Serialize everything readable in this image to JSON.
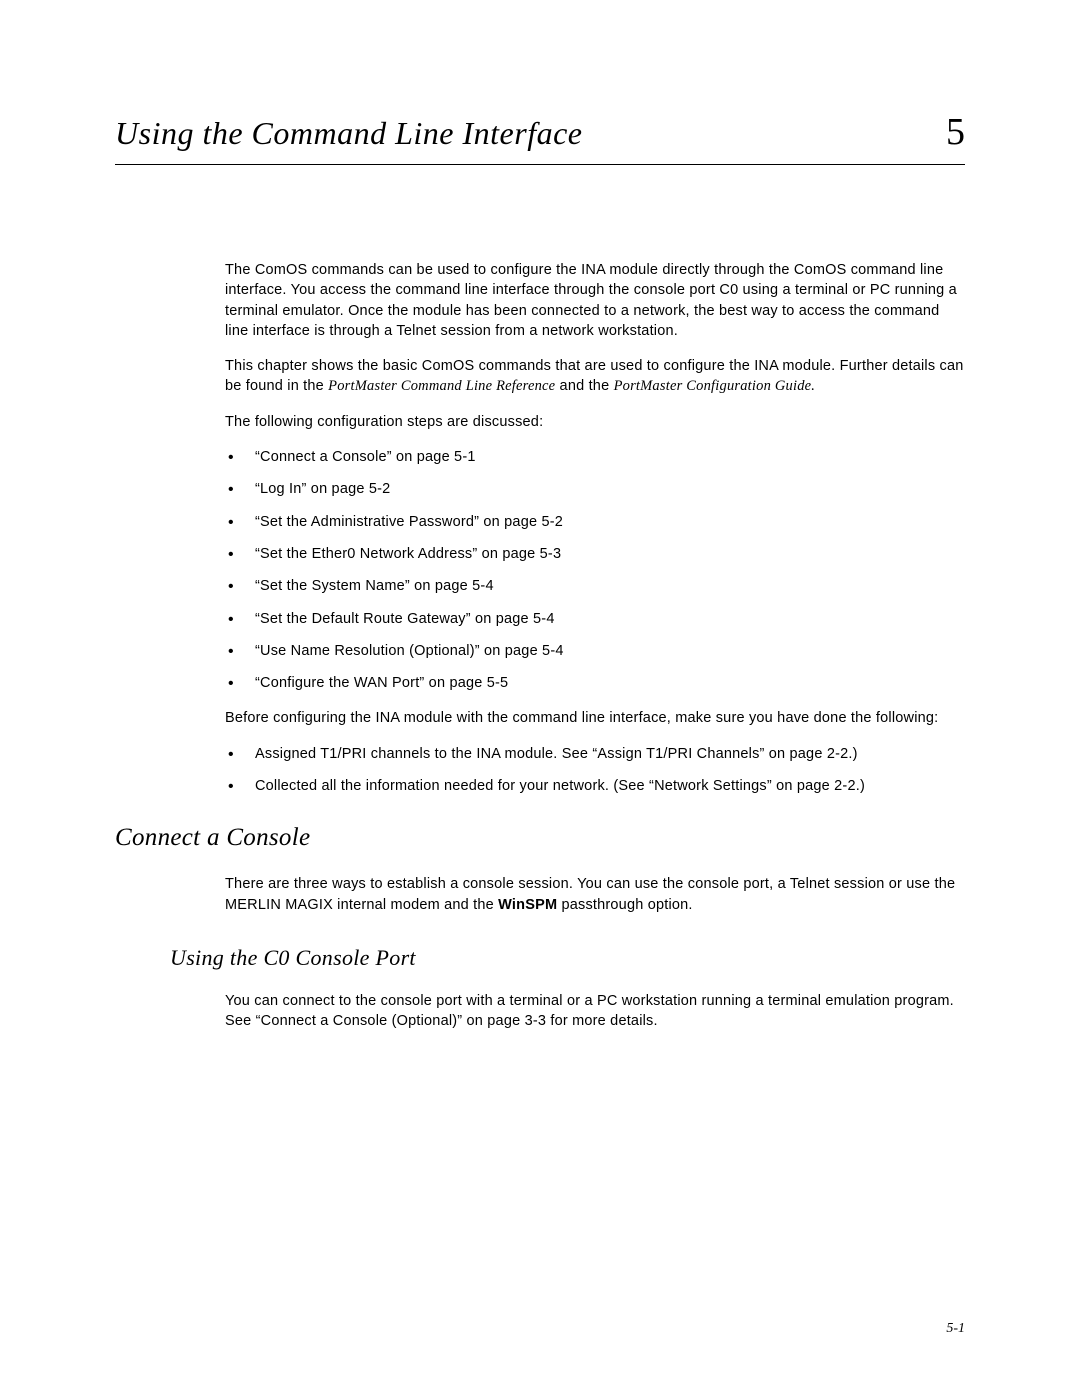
{
  "chapter": {
    "title": "Using the Command Line Interface",
    "number": "5"
  },
  "intro": {
    "p1": "The ComOS commands can be used to configure the INA module directly through the ComOS command line interface. You access the command line interface through the console port C0 using a terminal or PC running a terminal emulator. Once the module has been connected to a network, the best way to access the command line interface is through a Telnet session from a network workstation.",
    "p2a": "This chapter shows the basic ComOS commands that are used to configure the INA module. Further details can be found in the ",
    "p2_ital1": "PortMaster Command Line Reference",
    "p2b": " and the ",
    "p2_ital2": "PortMaster Configuration Guide.",
    "p3": "The following configuration steps are discussed:"
  },
  "steps": [
    "“Connect a Console” on page 5-1",
    "“Log In” on page 5-2",
    "“Set the Administrative Password” on page 5-2",
    "“Set the Ether0 Network Address” on page 5-3",
    "“Set the System Name” on page 5-4",
    "“Set the Default Route Gateway” on page 5-4",
    "“Use Name Resolution (Optional)” on page 5-4",
    "“Configure the WAN Port” on page 5-5"
  ],
  "prereq": {
    "intro": "Before configuring the INA module with the command line interface, make sure you have done the following:",
    "items": [
      "Assigned T1/PRI channels to the INA module. See “Assign T1/PRI Channels” on page 2-2.)",
      "Collected all the information needed for your network. (See “Network Settings” on page 2-2.)"
    ]
  },
  "section1": {
    "heading": "Connect a Console",
    "p1a": "There are three ways to establish a console session. You can use the console port, a Telnet session or use the MERLIN MAGIX internal modem and the ",
    "p1_bold": "WinSPM",
    "p1b": " passthrough option."
  },
  "subsection1": {
    "heading": "Using the C0 Console Port",
    "p1": "You can connect to the console port with a terminal or a PC workstation running a terminal emulation program. See “Connect a Console (Optional)” on page 3-3 for more details."
  },
  "pageNumber": "5-1"
}
